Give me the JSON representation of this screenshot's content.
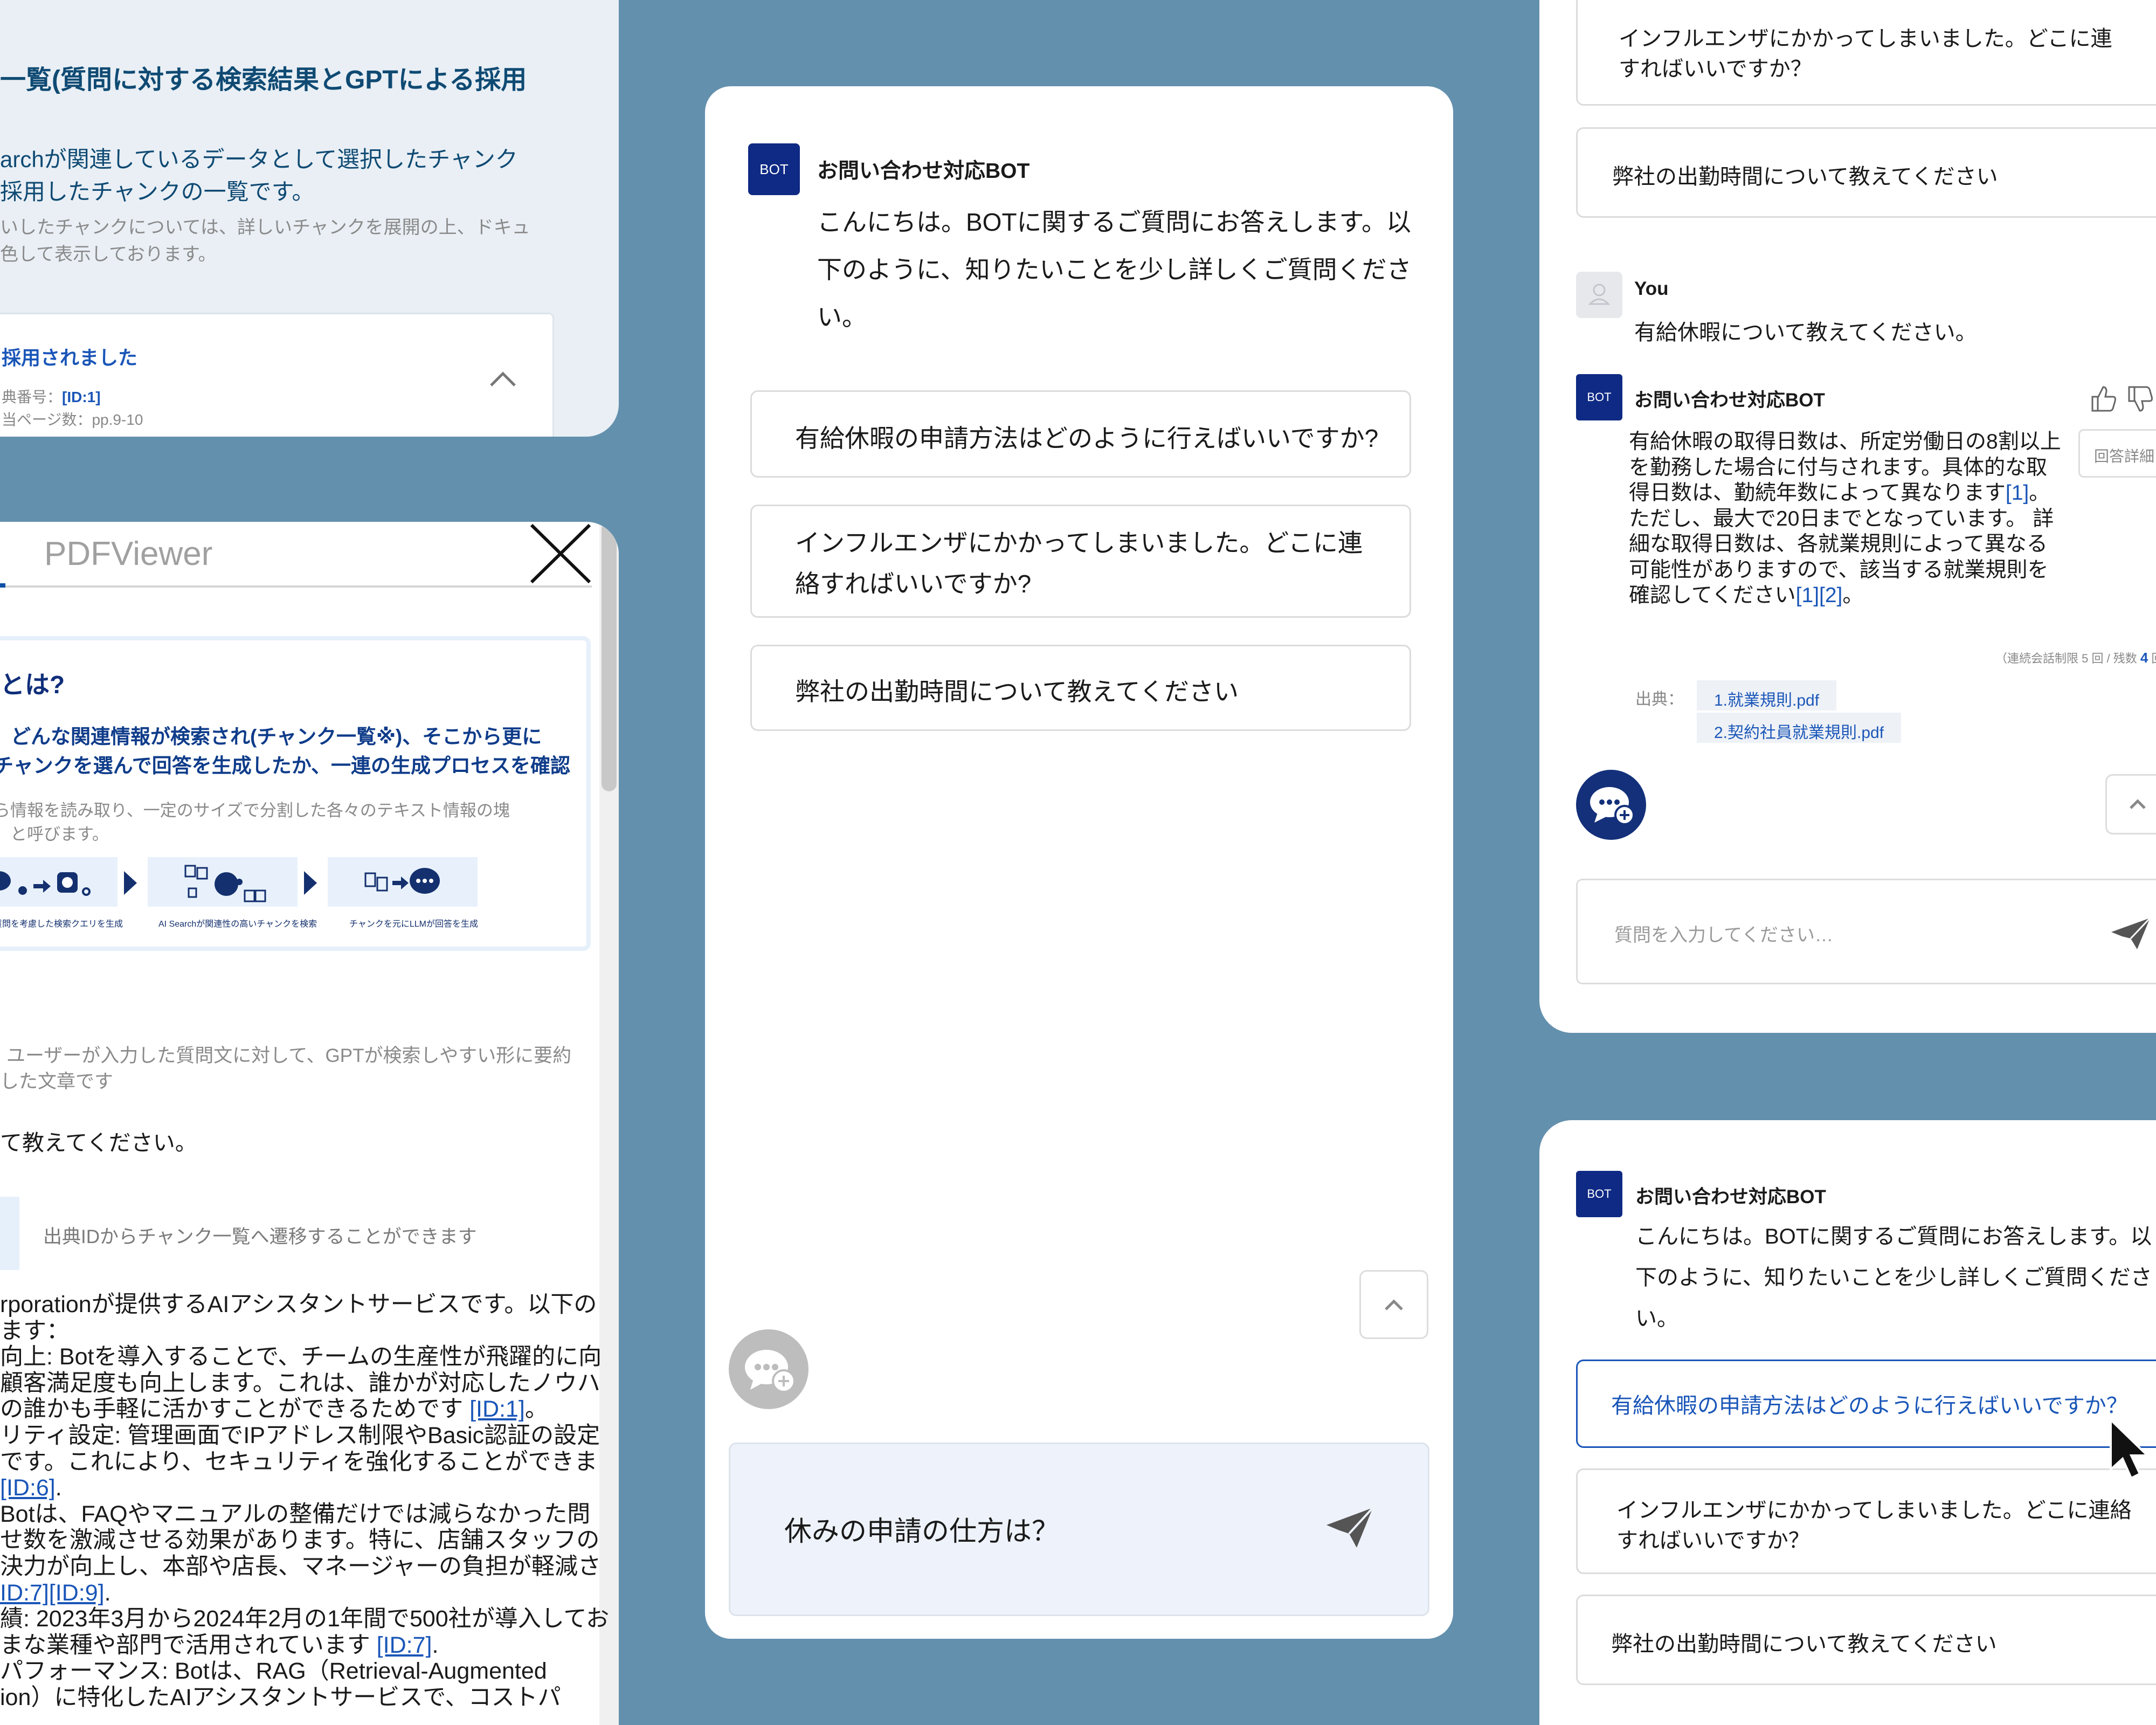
{
  "chunk_panel": {
    "title": "一覧(質問に対する検索結果とGPTによる採用",
    "desc_line1": "archが関連しているデータとして選択したチャンク",
    "desc_line2": "採用したチャンクの一覧です。",
    "note_line1": "いしたチャンクについては、詳しいチャンクを展開の上、ドキュ",
    "note_line2": "色して表示しております。",
    "adopted_label": "採用されました",
    "source_no_label": "典番号：",
    "source_id": "[ID:1]",
    "page_label": "当ページ数：pp.9-10"
  },
  "pdf_panel": {
    "title": "PDFViewer",
    "info_heading": "とは?",
    "info_line1": "どんな関連情報が検索され(チャンク一覧※)、そこから更に",
    "info_line2": "チャンクを選んで回答を生成したか、一連の生成プロセスを確認",
    "info_sub1": "ら情報を読み取り、一定のサイズで分割した各々のテキスト情報の塊",
    "info_sub2": "」と呼びます。",
    "flow_caption1": "質問を考慮した検索クエリを生成",
    "flow_caption2": "AI Searchが関連性の高いチャンクを検索",
    "flow_caption3": "チャンクを元にLLMが回答を生成",
    "query_desc1": "ユーザーが入力した質問文に対して、GPTが検索しやすい形に要約",
    "query_desc2": "した文章です",
    "query_text": "て教えてください。",
    "hint": "出典IDからチャンク一覧へ遷移することができます",
    "body_lines": [
      {
        "t": "rporationが提供するAIアシスタントサービスです。以下の",
        "ref": ""
      },
      {
        "t": "ます：",
        "ref": ""
      },
      {
        "t": "向上: Botを導入することで、チームの生産性が飛躍的に向",
        "ref": ""
      },
      {
        "t": "顧客満足度も向上します。これは、誰かが対応したノウハ",
        "ref": ""
      },
      {
        "t": "の誰かも手軽に活かすことができるためです ",
        "ref": "[ID:1]",
        "after": "。"
      },
      {
        "t": "リティ設定: 管理画面でIPアドレス制限やBasic認証の設定",
        "ref": ""
      },
      {
        "t": "です。これにより、セキュリティを強化することができま",
        "ref": ""
      },
      {
        "t": " ",
        "ref": "[ID:6]",
        "after": "."
      },
      {
        "t": "Botは、FAQやマニュアルの整備だけでは減らなかった問",
        "ref": ""
      },
      {
        "t": "せ数を激減させる効果があります。特に、店舗スタッフの",
        "ref": ""
      },
      {
        "t": "決力が向上し、本部や店長、マネージャーの負担が軽減さ",
        "ref": ""
      },
      {
        "t": "",
        "ref": "ID:7][ID:9]",
        "after": "."
      },
      {
        "t": "績: 2023年3月から2024年2月の1年間で500社が導入してお",
        "ref": ""
      },
      {
        "t": "まな業種や部門で活用されています ",
        "ref": "[ID:7]",
        "after": "."
      },
      {
        "t": "パフォーマンス: Botは、RAG（Retrieval-Augmented",
        "ref": ""
      },
      {
        "t": "ion）に特化したAIアシスタントサービスで、コストパ",
        "ref": ""
      }
    ]
  },
  "main_chat": {
    "bot_name": "お問い合わせ対応BOT",
    "avatar_text": "BOT",
    "greeting_lines": [
      "こんにちは。BOTに関するご質問にお答えします。以",
      "下のように、知りたいことを少し詳しくご質問くださ",
      "い。"
    ],
    "suggestions": [
      {
        "lines": [
          "有給休暇の申請方法はどのように行えばいいですか?"
        ]
      },
      {
        "lines": [
          "インフルエンザにかかってしまいました。どこに連",
          "絡すればいいですか?"
        ]
      },
      {
        "lines": [
          "弊社の出勤時間について教えてください"
        ]
      }
    ],
    "input_value": "休みの申請の仕方は？"
  },
  "right_top": {
    "sugg_prev_lines": [
      "インフルエンザにかかってしまいました。どこに連",
      "すればいいですか？"
    ],
    "sugg_prev2": "弊社の出勤時間について教えてください",
    "user_name": "You",
    "user_msg": "有給休暇について教えてください。",
    "bot_name": "お問い合わせ対応BOT",
    "avatar_text": "BOT",
    "answer_lines": [
      {
        "t": "有給休暇の取得日数は、所定労働日の8割以上",
        "ref": "",
        "after": ""
      },
      {
        "t": "を勤務した場合に付与されます。具体的な取",
        "ref": "",
        "after": ""
      },
      {
        "t": "得日数は、勤続年数によって異なります",
        "ref": "[1]",
        "after": "。"
      },
      {
        "t": "ただし、最大で20日までとなっています。 詳",
        "ref": "",
        "after": ""
      },
      {
        "t": "細な取得日数は、各就業規則によって異なる",
        "ref": "",
        "after": ""
      },
      {
        "t": "可能性がありますので、該当する就業規則を",
        "ref": "",
        "after": ""
      },
      {
        "t": "確認してください",
        "ref": "[1][2]",
        "after": "。"
      }
    ],
    "detail_button": "回答詳細",
    "limit_text_a": "（連続会話制限 5 回 / 残数 ",
    "limit_remaining": "4",
    "limit_text_b": " 回",
    "source_label": "出典：",
    "sources": [
      "1.就業規則.pdf",
      "2.契約社員就業規則.pdf"
    ],
    "input_placeholder": "質問を入力してください…"
  },
  "right_bottom": {
    "bot_name": "お問い合わせ対応BOT",
    "avatar_text": "BOT",
    "greeting_lines": [
      "こんにちは。BOTに関するご質問にお答えします。以",
      "下のように、知りたいことを少し詳しくご質問くださ",
      "い。"
    ],
    "suggestion_selected": "有給休暇の申請方法はどのように行えばいいですか？",
    "suggestion2_lines": [
      "インフルエンザにかかってしまいました。どこに連絡",
      "すればいいですか？"
    ],
    "suggestion3": "弊社の出勤時間について教えてください"
  },
  "colors": {
    "background": "#6390ad",
    "bot_avatar": "#0f2a84",
    "link": "#1a56b8",
    "selected_border": "#1a56b8",
    "input_bg": "#eef3fb"
  }
}
